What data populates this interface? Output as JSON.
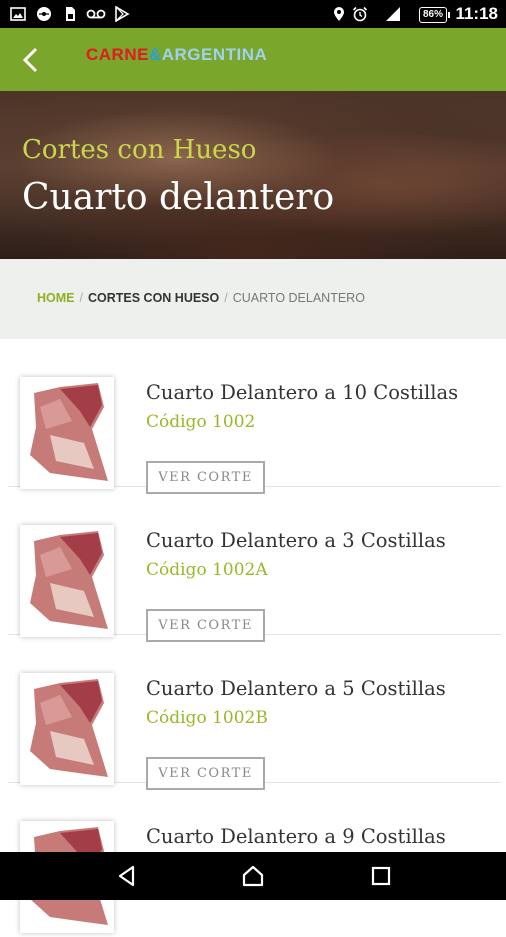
{
  "status_bar": {
    "time": "11:18",
    "battery": "86%",
    "left_icons": [
      "image-icon",
      "disc-icon",
      "sim-icon",
      "voicemail-icon",
      "play-store-icon"
    ],
    "right_icons": [
      "location-icon",
      "alarm-icon",
      "signal-icon",
      "battery-icon"
    ]
  },
  "app_bar": {
    "logo_part1": "CARNE",
    "logo_part2": "&",
    "logo_part3": "ARGENTINA",
    "colors": {
      "background": "#7aa62b",
      "logo_red": "#e11b22",
      "logo_blue": "#2a9fd6"
    }
  },
  "hero": {
    "subtitle": "Cortes con Hueso",
    "title": "Cuarto delantero"
  },
  "breadcrumb": {
    "home": "HOME",
    "separator": "/",
    "section": "CORTES CON HUESO",
    "current": "CUARTO DELANTERO"
  },
  "products": [
    {
      "title": "Cuarto Delantero a 10 Costillas",
      "code": "Código 1002",
      "button": "VER CORTE",
      "image": "beef-cut-image"
    },
    {
      "title": "Cuarto Delantero a 3 Costillas",
      "code": "Código 1002A",
      "button": "VER CORTE",
      "image": "beef-cut-image"
    },
    {
      "title": "Cuarto Delantero a 5 Costillas",
      "code": "Código 1002B",
      "button": "VER CORTE",
      "image": "beef-cut-image"
    },
    {
      "title": "Cuarto Delantero a 9 Costillas",
      "code": "",
      "button": "",
      "image": "beef-cut-image"
    }
  ],
  "nav_bar": {
    "icons": [
      "back-triangle-icon",
      "home-circle-icon",
      "recents-square-icon"
    ]
  },
  "accent_green": "#96b928"
}
